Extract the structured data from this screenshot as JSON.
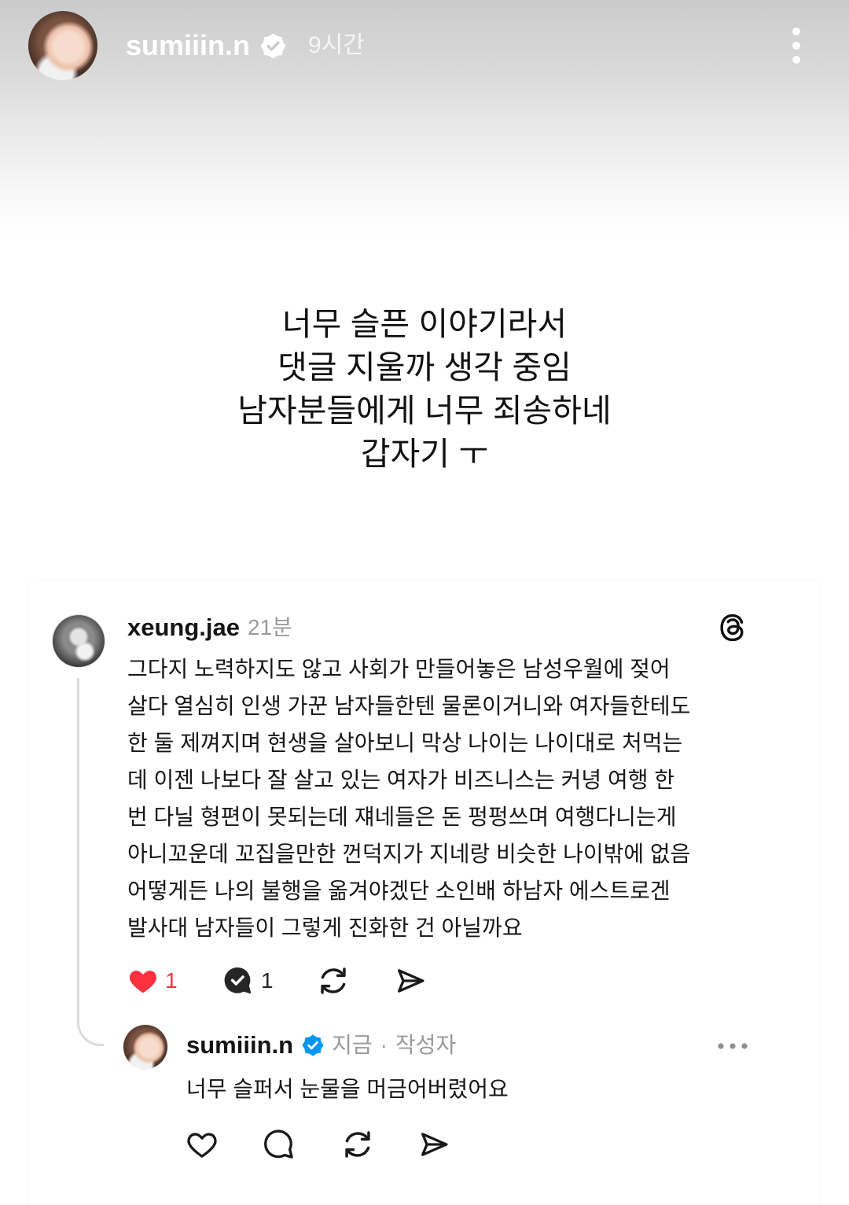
{
  "story": {
    "username": "sumiiin.n",
    "verified": true,
    "time": "9시간",
    "text_lines": [
      "너무 슬픈 이야기라서",
      "댓글 지울까 생각 중임",
      "남자분들에게 너무 죄송하네",
      "갑자기 ㅜ"
    ],
    "menu_icon": "more-vertical-icon"
  },
  "thread_post": {
    "username": "xeung.jae",
    "time": "21분",
    "app_icon": "threads-logo-icon",
    "body_lines": [
      "그다지 노력하지도 않고 사회가 만들어놓은 남성우월에 젖어",
      "살다 열심히 인생 가꾼 남자들한텐 물론이거니와 여자들한테도",
      "한 둘 제껴지며 현생을 살아보니 막상 나이는 나이대로 처먹는",
      "데 이젠 나보다 잘 살고 있는 여자가 비즈니스는 커녕 여행 한",
      "번 다닐 형편이 못되는데 쟤네들은 돈 펑펑쓰며 여행다니는게",
      "아니꼬운데 꼬집을만한 껀덕지가 지네랑 비슷한 나이밖에 없음",
      "어떻게든 나의 불행을 옮겨야겠단 소인배 하남자 에스트로겐",
      "발사대 남자들이 그렇게 진화한 건 아닐까요"
    ],
    "actions": {
      "liked": true,
      "like_count": "1",
      "replied": true,
      "reply_count": "1",
      "icons": [
        "heart-filled-icon",
        "comment-replied-icon",
        "repost-icon",
        "send-icon"
      ]
    }
  },
  "reply": {
    "username": "sumiiin.n",
    "verified": true,
    "time": "지금",
    "separator": "·",
    "role": "작성자",
    "text": "너무 슬퍼서 눈물을 머금어버렸어요",
    "menu_icon": "more-horizontal-icon",
    "actions": {
      "icons": [
        "heart-icon",
        "comment-icon",
        "repost-icon",
        "send-icon"
      ]
    }
  },
  "colors": {
    "like_red": "#ff3040",
    "verified_blue": "#0095f6",
    "text_primary": "#111111",
    "text_secondary": "#9a9a9a",
    "thread_line": "#dcdcdc"
  }
}
